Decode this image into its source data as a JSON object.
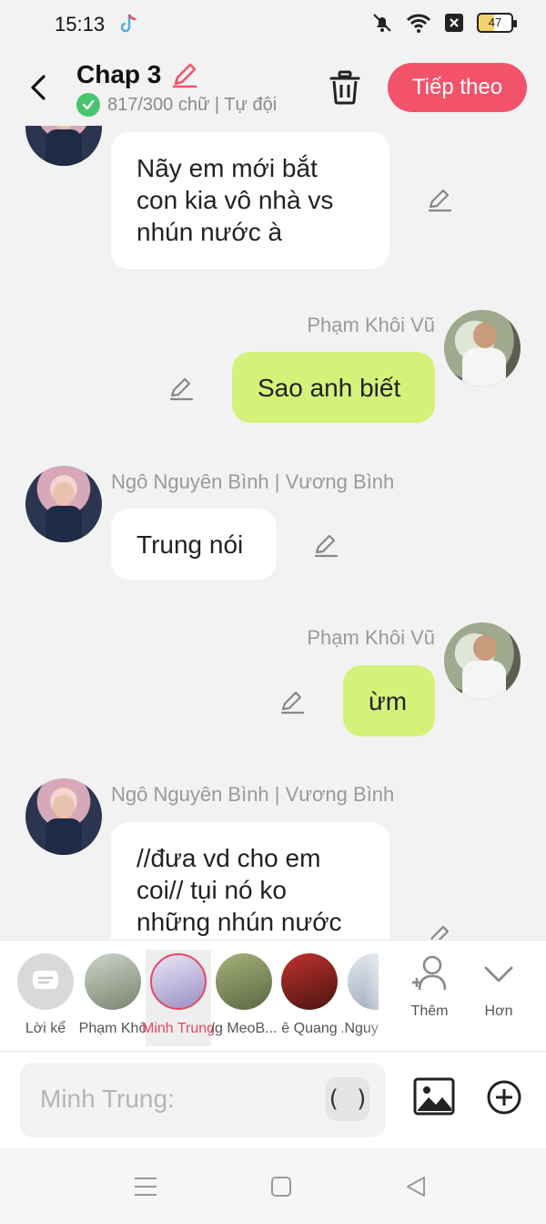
{
  "status_bar": {
    "time": "15:13",
    "battery": "47"
  },
  "header": {
    "title": "Chap 3",
    "subtitle": "817/300 chữ | Tự đội",
    "next_label": "Tiếp theo"
  },
  "messages": [
    {
      "sender": "",
      "text_lines": [
        "Nãy em mới bắt",
        "con kia vô nhà vs",
        "nhún nước à"
      ]
    },
    {
      "sender": "Phạm Khôi Vũ",
      "text": "Sao anh biết"
    },
    {
      "sender": "Ngô Nguyên Bình | Vương Bình",
      "text": "Trung nói"
    },
    {
      "sender": "Phạm Khôi Vũ",
      "text": "ừm"
    },
    {
      "sender": "Ngô Nguyên Bình | Vương Bình",
      "text_lines": [
        "//đưa vd cho em",
        "coi// tụi nó ko",
        "những nhún nước"
      ]
    }
  ],
  "characters": [
    {
      "label": "Lời kể"
    },
    {
      "label": "Phạm Khô"
    },
    {
      "label": "Minh Trung"
    },
    {
      "label": "/g MeoB..."
    },
    {
      "label": "ê Quang"
    },
    {
      "label": ".Nguyê"
    }
  ],
  "tools": {
    "add_label": "Thêm",
    "more_label": "Hơn"
  },
  "input": {
    "placeholder": "Minh Trung:",
    "paren": "( )"
  },
  "icons": {
    "back": "back-arrow-icon",
    "edit_title": "pencil-icon",
    "verified": "check-circle-icon",
    "delete": "trash-icon",
    "edit_message": "pencil-icon",
    "narrator": "chat-bubble-icon",
    "add_character": "add-person-icon",
    "more": "chevron-down-icon",
    "image": "image-icon",
    "add": "plus-circle-icon"
  },
  "colors": {
    "accent": "#f2536b",
    "my_bubble": "#d4f27a",
    "check": "#47c56c"
  }
}
